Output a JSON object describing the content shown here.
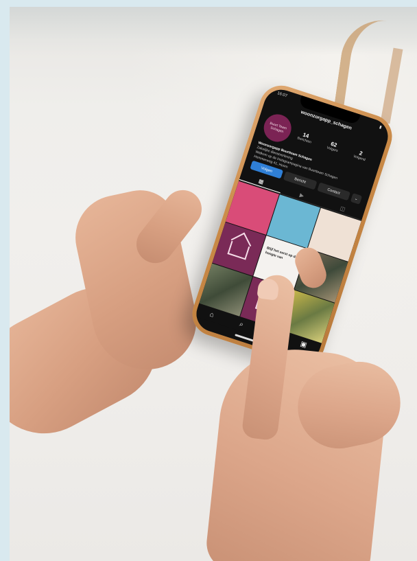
{
  "scene": {
    "description_tag": "photo"
  },
  "phone": {
    "status_time": "16:07",
    "username": "woonzorgapp_schagen",
    "avatar_text": "Buurt Team Schagen",
    "stats": [
      {
        "value": "14",
        "label": "Berichten"
      },
      {
        "value": "62",
        "label": "Volgers"
      },
      {
        "value": "2",
        "label": "Volgend"
      }
    ],
    "bio_name": "Woonzorgapp Buurtteam Schagen",
    "bio_lines": [
      "Zakelijke dienstverlening",
      "Welkom op de Instagrampagina van Buurtteam Schagen",
      "Hemmerweg 41, Hoorn"
    ],
    "buttons": {
      "primary": "Volgen",
      "message": "Bericht",
      "contact": "Contact",
      "more": "⌄"
    },
    "tiles_text": "Blijf het eerst op de hoogte van"
  },
  "colors": {
    "brand_purple": "#7a2a57",
    "brand_pink": "#d94c78",
    "ig_blue": "#2f7fd6"
  }
}
